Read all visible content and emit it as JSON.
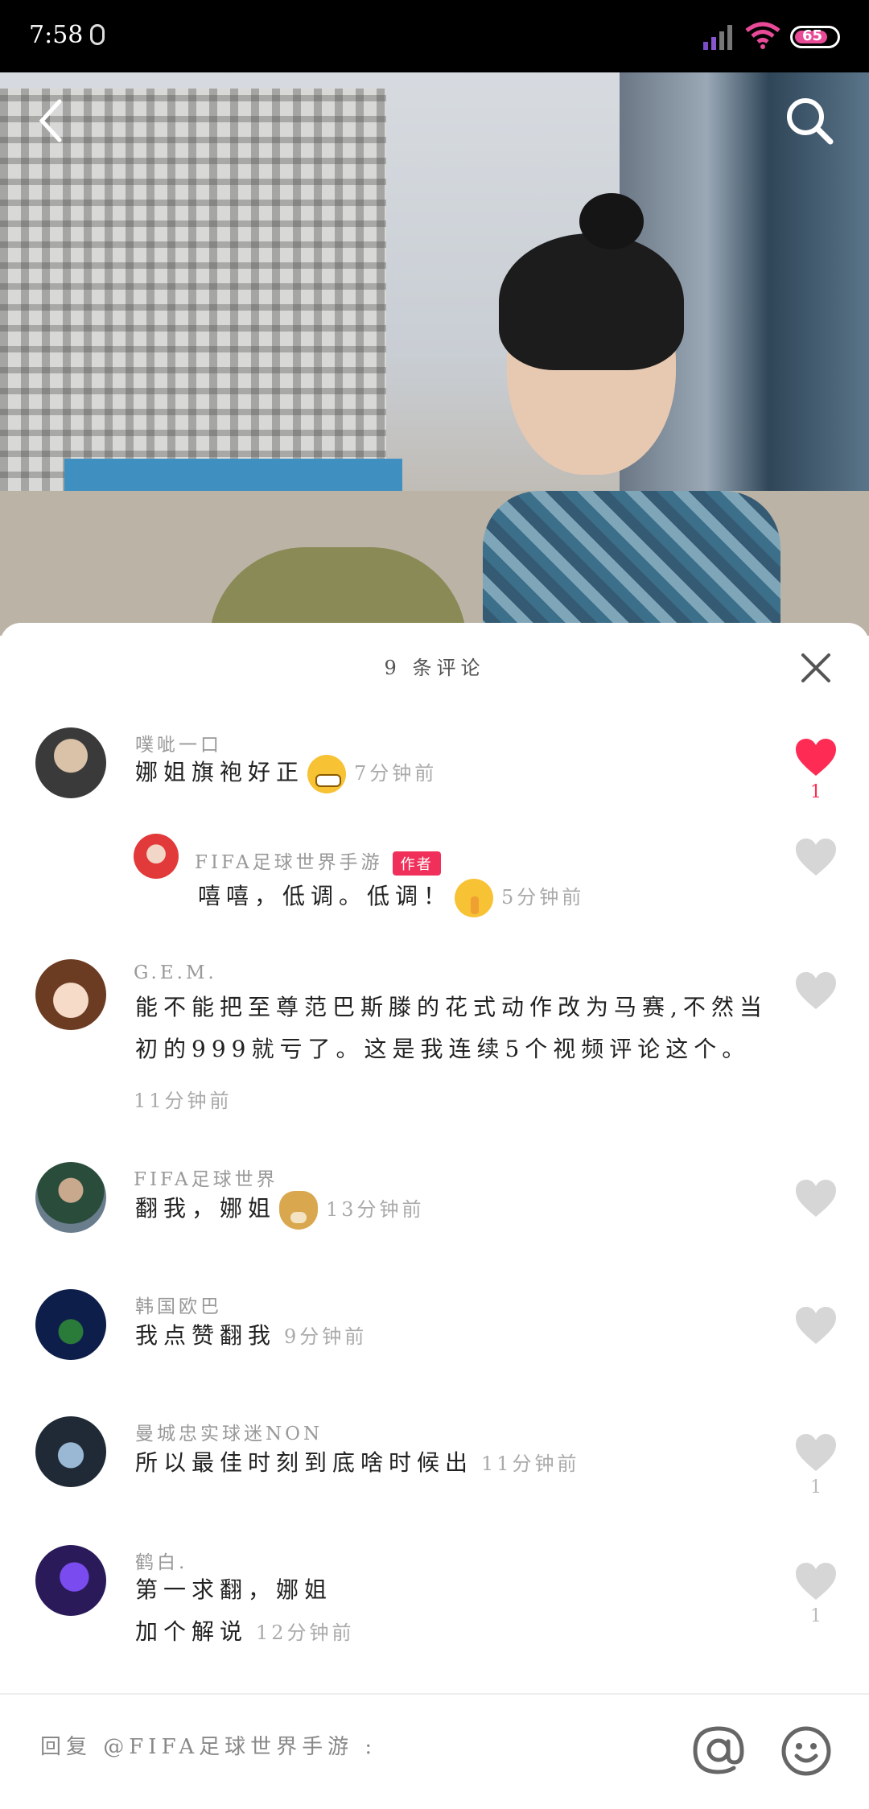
{
  "status_bar": {
    "time": "7:58",
    "battery": "65"
  },
  "video": {
    "back_icon": "chevron-left-icon",
    "search_icon": "search-icon"
  },
  "comments_sheet": {
    "title": "9 条评论",
    "comments": [
      {
        "name": "噗呲一口",
        "text": "娜姐旗袍好正",
        "time": "7分钟前",
        "likes": "1",
        "liked": true
      },
      {
        "name": "FIFA足球世界手游",
        "badge": "作者",
        "text": "嘻嘻，低调。低调！",
        "time": "5分钟前",
        "reply": true
      },
      {
        "name": "G.E.M.",
        "text_line1": "能不能把至尊范巴斯滕的花式动作改为马赛,不然当",
        "text_line2": "初的999就亏了。这是我连续5个视频评论这个。",
        "time": "11分钟前"
      },
      {
        "name": "FIFA足球世界",
        "text": "翻我，娜姐",
        "time": "13分钟前"
      },
      {
        "name": "韩国欧巴",
        "text": "我点赞翻我",
        "time": "9分钟前"
      },
      {
        "name": "曼城忠实球迷NON",
        "text": "所以最佳时刻到底啥时候出",
        "time": "11分钟前",
        "likes": "1"
      },
      {
        "name": "鹤白.",
        "text_line1": "第一求翻，娜姐",
        "text_line2": "加个解说",
        "time": "12分钟前",
        "likes": "1"
      }
    ]
  },
  "reply_bar": {
    "placeholder": "回复 @FIFA足球世界手游 :"
  },
  "colors": {
    "liked": "#fe2c55",
    "unliked": "#d6d6d6",
    "author_badge": "#f0305a"
  }
}
